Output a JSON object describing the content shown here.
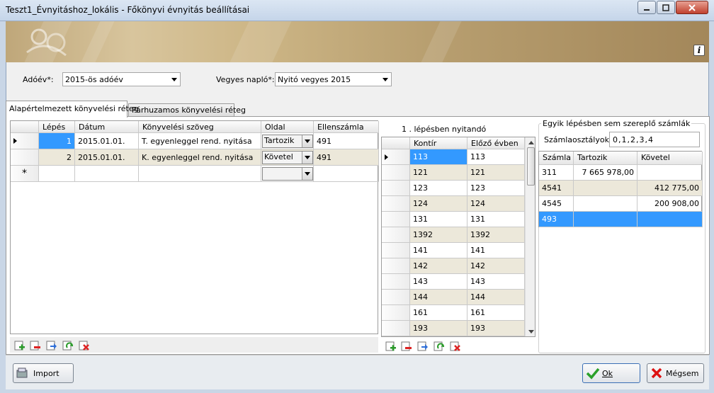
{
  "window": {
    "title": "Teszt1_Évnyitáshoz_lokális - Főkönyvi évnyitás beállításai"
  },
  "filters": {
    "adoev_label": "Adóév*:",
    "adoev_value": "2015-ös adóév",
    "vegyes_label": "Vegyes napló*:",
    "vegyes_value": "Nyitó vegyes 2015"
  },
  "tabs": [
    {
      "label": "Alapértelmezett könyvelési réteg"
    },
    {
      "label": "Párhuzamos könyvelési réteg"
    }
  ],
  "main_grid": {
    "headers": [
      "Lépés",
      "Dátum",
      "Könyvelési szöveg",
      "Oldal",
      "Ellenszámla"
    ],
    "rows": [
      {
        "lepes": "1",
        "datum": "2015.01.01.",
        "szoveg": "T. egyenleggel  rend. nyitása",
        "oldal": "Tartozik",
        "ellen": "491"
      },
      {
        "lepes": "2",
        "datum": "2015.01.01.",
        "szoveg": "K. egyenleggel  rend. nyitása",
        "oldal": "Követel",
        "ellen": "491"
      }
    ],
    "newrow_marker": "*"
  },
  "middle_panel": {
    "caption": "1 . lépésben nyitandó",
    "headers": [
      "Kontír",
      "Előző évben"
    ],
    "rows": [
      [
        "113",
        "113"
      ],
      [
        "121",
        "121"
      ],
      [
        "123",
        "123"
      ],
      [
        "124",
        "124"
      ],
      [
        "131",
        "131"
      ],
      [
        "1392",
        "1392"
      ],
      [
        "141",
        "141"
      ],
      [
        "142",
        "142"
      ],
      [
        "143",
        "143"
      ],
      [
        "144",
        "144"
      ],
      [
        "161",
        "161"
      ],
      [
        "193",
        "193"
      ]
    ]
  },
  "right_panel": {
    "group_title": "Egyik lépésben sem szereplő számlák",
    "szamlaosztaly_label": "Számlaosztályok:",
    "szamlaosztaly_value": "0,1,2,3,4",
    "headers": [
      "Számla",
      "Tartozik",
      "Követel"
    ],
    "rows": [
      [
        "311",
        "7 665 978,00",
        ""
      ],
      [
        "4541",
        "",
        "412 775,00"
      ],
      [
        "4545",
        "",
        "200 908,00"
      ],
      [
        "493",
        "",
        ""
      ]
    ]
  },
  "buttons": {
    "import": "Import",
    "ok": "Ok",
    "megsem": "Mégsem"
  },
  "colors": {
    "selection": "#3399ff",
    "alt_row": "#ece8da"
  },
  "icons": [
    "add-icon",
    "remove-icon",
    "move-icon",
    "refresh-icon",
    "delete-icon",
    "info-icon",
    "import-icon",
    "ok-check-icon",
    "cancel-x-icon"
  ]
}
